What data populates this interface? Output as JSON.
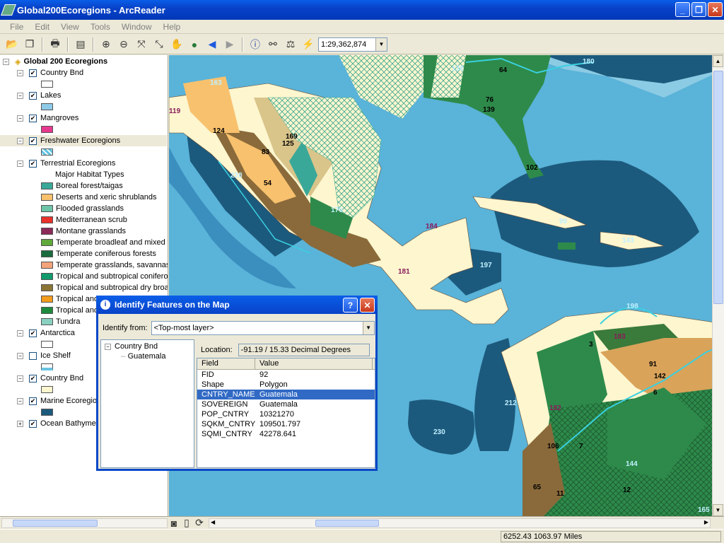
{
  "window": {
    "title": "Global200Ecoregions - ArcReader",
    "minimize": "_",
    "maximize": "❐",
    "close": "✕"
  },
  "menu": [
    "File",
    "Edit",
    "View",
    "Tools",
    "Window",
    "Help"
  ],
  "toolbar": {
    "scale": "1:29,362,874"
  },
  "toc": {
    "root": "Global 200 Ecoregions",
    "layers": [
      {
        "name": "Country Bnd",
        "checked": true,
        "swatch": "#ffffff"
      },
      {
        "name": "Lakes",
        "checked": true,
        "swatch": "#8ecbe8"
      },
      {
        "name": "Mangroves",
        "checked": true,
        "swatch": "#e7388f"
      },
      {
        "name": "Freshwater Ecoregions",
        "checked": true,
        "swatch": "#61c3e2"
      },
      {
        "name": "Terrestrial Ecoregions",
        "checked": true
      },
      {
        "name": "Antarctica",
        "checked": true,
        "swatch": "#ffffff"
      },
      {
        "name": "Ice Shelf",
        "checked": false,
        "swatch": "#ffffff"
      },
      {
        "name": "Country Bnd",
        "checked": true,
        "swatch": "#fdf6cf"
      },
      {
        "name": "Marine Ecoregio",
        "checked": true,
        "swatch": "#1c5a7d"
      },
      {
        "name": "Ocean Bathyme",
        "checked": true
      }
    ],
    "habitat_header": "Major Habitat Types",
    "habitats": [
      {
        "label": "Boreal forest/taigas",
        "color": "#3aa898"
      },
      {
        "label": "Deserts and xeric shrublands",
        "color": "#f8c16e"
      },
      {
        "label": "Flooded grasslands",
        "color": "#6cc5a8"
      },
      {
        "label": "Mediterranean scrub",
        "color": "#e8322b"
      },
      {
        "label": "Montane grasslands",
        "color": "#8c2a5a"
      },
      {
        "label": "Temperate broadleaf and mixed f",
        "color": "#5fa83c"
      },
      {
        "label": "Temperate coniferous forests",
        "color": "#1a6b3d"
      },
      {
        "label": "Temperate grasslands, savannas",
        "color": "#f4a37a"
      },
      {
        "label": "Tropical and subtropical conifero",
        "color": "#119a6c"
      },
      {
        "label": "Tropical and subtropical dry broa",
        "color": "#8a7535"
      },
      {
        "label": "Tropical and",
        "color": "#f39c1d"
      },
      {
        "label": "Tropical and",
        "color": "#1d8a3c"
      },
      {
        "label": "Tundra",
        "color": "#8ad0c0"
      }
    ]
  },
  "dialog": {
    "title": "Identify Features on the Map",
    "help": "?",
    "close": "✕",
    "identify_label": "Identify from:",
    "identify_value": "<Top-most layer>",
    "tree_root": "Country Bnd",
    "tree_child": "Guatemala",
    "location_label": "Location:",
    "location_value": "-91.19 / 15.33 Decimal Degrees",
    "col_field": "Field",
    "col_value": "Value",
    "rows": [
      {
        "field": "FID",
        "value": "92"
      },
      {
        "field": "Shape",
        "value": "Polygon"
      },
      {
        "field": "CNTRY_NAME",
        "value": "Guatemala"
      },
      {
        "field": "SOVEREIGN",
        "value": "Guatemala"
      },
      {
        "field": "POP_CNTRY",
        "value": "10321270"
      },
      {
        "field": "SQKM_CNTRY",
        "value": "109501.797"
      },
      {
        "field": "SQMI_CNTRY",
        "value": "42278.641"
      }
    ]
  },
  "status": {
    "coords": "6252.43  1063.97 Miles"
  },
  "map_labels": [
    "163",
    "138",
    "64",
    "180",
    "119",
    "124",
    "76",
    "139",
    "169",
    "83",
    "125",
    "102",
    "228",
    "54",
    "170",
    "184",
    "99",
    "143",
    "197",
    "181",
    "198",
    "183",
    "3",
    "91",
    "142",
    "212",
    "182",
    "230",
    "106",
    "7",
    "144",
    "65",
    "11",
    "12",
    "165",
    "6"
  ]
}
